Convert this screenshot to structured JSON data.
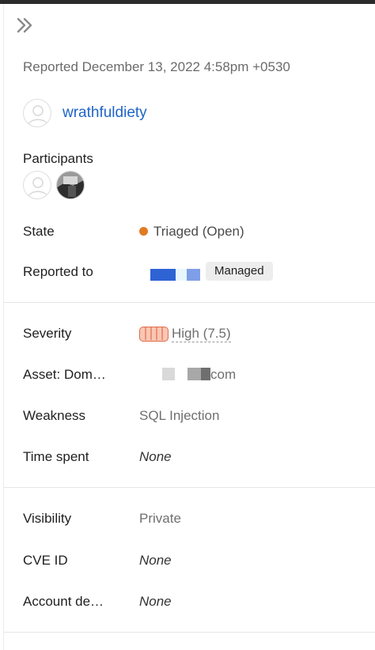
{
  "header": {
    "collapse_icon": "double-chevron-right-icon",
    "reported_text": "Reported December 13, 2022 4:58pm +0530"
  },
  "reporter": {
    "username": "wrathfuldiety",
    "avatar_icon": "default-avatar-icon"
  },
  "participants": {
    "label": "Participants",
    "avatars": [
      "default-avatar-icon",
      "photo-avatar-icon"
    ]
  },
  "state": {
    "label": "State",
    "value": "Triaged (Open)",
    "dot_color": "#e07b22"
  },
  "reported_to": {
    "label": "Reported to",
    "badge": "Managed"
  },
  "severity": {
    "label": "Severity",
    "value": "High (7.5)",
    "color": "#e06b4a"
  },
  "asset": {
    "label": "Asset: Dom…",
    "value_suffix": "com"
  },
  "weakness": {
    "label": "Weakness",
    "value": "SQL Injection"
  },
  "time_spent": {
    "label": "Time spent",
    "value": "None"
  },
  "visibility": {
    "label": "Visibility",
    "value": "Private"
  },
  "cve": {
    "label": "CVE ID",
    "value": "None"
  },
  "account": {
    "label": "Account de…",
    "value": "None"
  },
  "colors": {
    "link": "#1f64c8",
    "label": "#1f1f1f",
    "muted": "#6f6f6f"
  }
}
